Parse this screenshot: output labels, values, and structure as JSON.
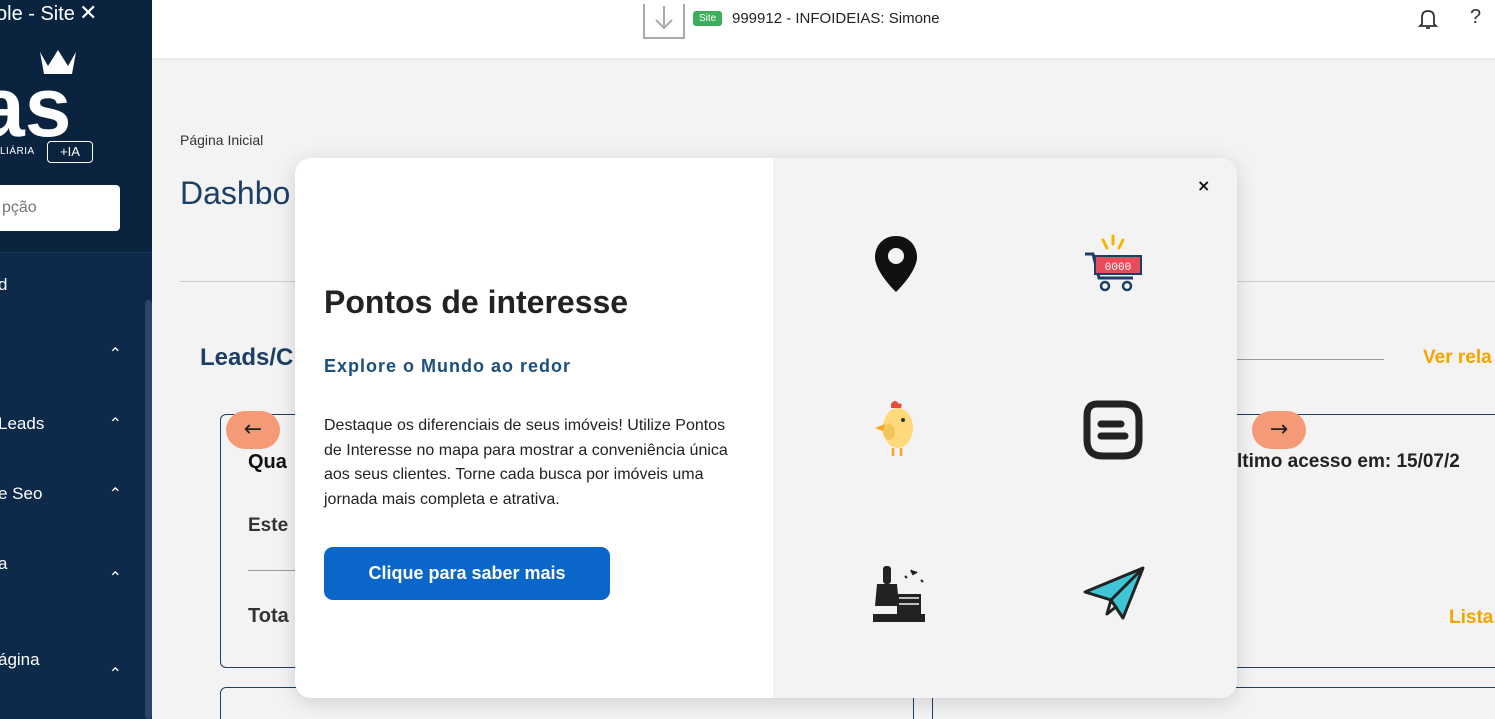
{
  "sidebar": {
    "tab_title": "ole - Site",
    "logo_text": "as",
    "logo_subtitle": "LIÁRIA",
    "ia_badge": "+IA",
    "search_placeholder": "pção",
    "items": [
      {
        "label": "d"
      },
      {
        "label": ""
      },
      {
        "label": "Leads"
      },
      {
        "label": "e Seo"
      },
      {
        "label": "a"
      },
      {
        "label": "ágina"
      }
    ]
  },
  "topbar": {
    "site_badge": "Site",
    "title": "999912 - INFOIDEIAS: Simone",
    "help_label": "?"
  },
  "page": {
    "breadcrumb": "Página Inicial",
    "title": "Dashbo",
    "section_title": "Leads/C",
    "view_report_link": "Ver rela",
    "card_line_1": "Qua",
    "card_line_2": "Este",
    "card_line_3": "Tota",
    "last_access": "ltimo acesso em: 15/07/2",
    "list_link": "Lista"
  },
  "carousel": {
    "prev_arrow": "←",
    "next_arrow": "→"
  },
  "modal": {
    "close_label": "×",
    "title": "Pontos de interesse",
    "subtitle": "Explore o Mundo ao redor",
    "description": "Destaque os diferenciais de seus imóveis! Utilize Pontos de Interesse no mapa para mostrar a conveniência única aos seus clientes. Torne cada busca por imóveis uma jornada mais completa e atrativa.",
    "cta_label": "Clique para saber mais",
    "icons": [
      "map-pin-icon",
      "shopping-cart-icon",
      "chick-icon",
      "blogger-icon",
      "paint-brush-icon",
      "paper-plane-icon"
    ],
    "cart_display_text": "0000"
  },
  "colors": {
    "sidebar_bg": "#0d2a4a",
    "primary_blue": "#0a66c9",
    "title_blue": "#1b3f66",
    "accent_orange": "#f5a400",
    "arrow_bg": "#f59a77",
    "site_badge_green": "#3cae5b"
  }
}
